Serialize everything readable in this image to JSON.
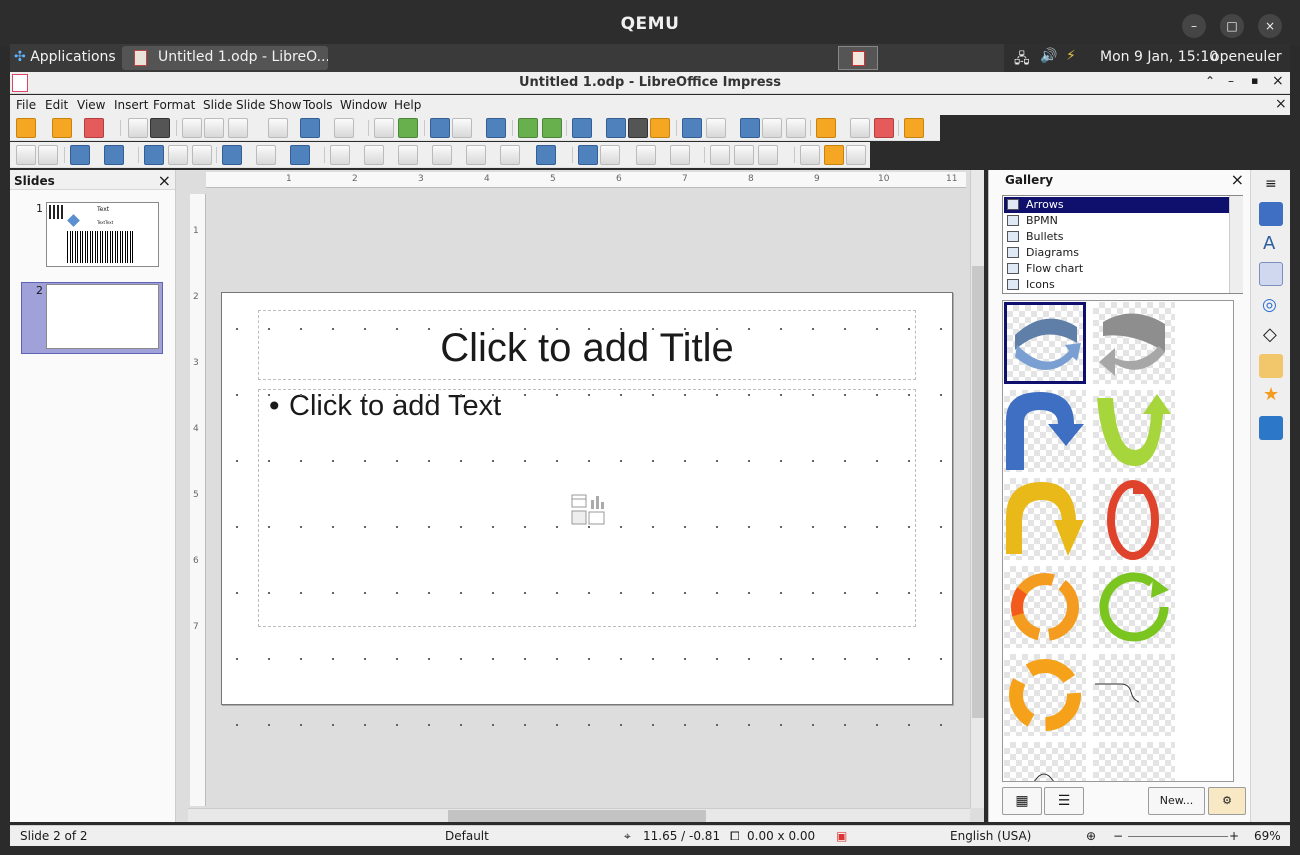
{
  "qemu": {
    "title": "QEMU",
    "minimize": "–",
    "maximize": "□",
    "close": "×"
  },
  "taskbar": {
    "applications": "Applications",
    "task_label": "Untitled 1.odp - LibreO...",
    "clock": "Mon  9 Jan, 15:10",
    "user": "openeuler"
  },
  "window": {
    "title": "Untitled 1.odp - LibreOffice Impress"
  },
  "menu": [
    "File",
    "Edit",
    "View",
    "Insert",
    "Format",
    "Slide",
    "Slide Show",
    "Tools",
    "Window",
    "Help"
  ],
  "slides_pane": {
    "title": "Slides",
    "close": "×",
    "slide1_num": "1",
    "slide2_num": "2",
    "thumb1_text": "Text",
    "thumb1_sub": "TextText"
  },
  "slide": {
    "title_placeholder": "Click to add Title",
    "text_placeholder": "Click to add Text",
    "bullet": "•"
  },
  "ruler": {
    "h_ticks": [
      "1",
      "2",
      "3",
      "4",
      "5",
      "6",
      "7",
      "8",
      "9",
      "10",
      "11"
    ],
    "v_ticks": [
      "1",
      "2",
      "3",
      "4",
      "5",
      "6",
      "7"
    ]
  },
  "gallery": {
    "title": "Gallery",
    "close": "×",
    "themes": [
      "Arrows",
      "BPMN",
      "Bullets",
      "Diagrams",
      "Flow chart",
      "Icons"
    ],
    "selected_theme": "Arrows",
    "new_button": "New..."
  },
  "statusbar": {
    "slide_info": "Slide 2 of 2",
    "layout": "Default",
    "position": "11.65 / -0.81",
    "size": "0.00 x 0.00",
    "language": "English (USA)",
    "zoom": "69%"
  },
  "colors": {
    "selection": "#0f0f6e",
    "slide_selected": "#9fa1d8"
  }
}
